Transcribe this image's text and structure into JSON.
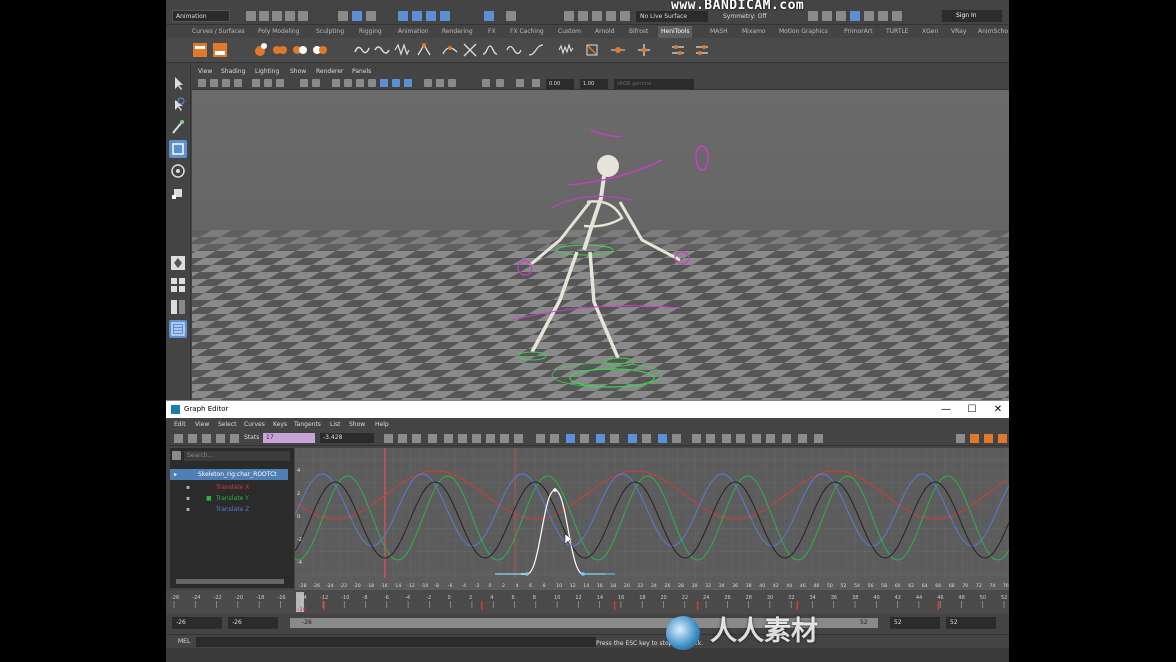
{
  "watermark_top": "www.BANDICAM.com",
  "status_line": {
    "mode": "Animation",
    "live_surface": "No Live Surface",
    "symmetry": "Symmetry: Off",
    "sign_in": "Sign In"
  },
  "shelf": {
    "tabs": [
      "Curves / Surfaces",
      "Poly Modeling",
      "Sculpting",
      "Rigging",
      "Animation",
      "Rendering",
      "FX",
      "FX Caching",
      "Custom",
      "Arnold",
      "Bifrost",
      "HeniTools",
      "MASH",
      "Mixamo",
      "Motion Graphics",
      "PrimorArt",
      "TURTLE",
      "XGen",
      "VRay",
      "AnimScho"
    ],
    "active_tab": "HeniTools"
  },
  "viewport": {
    "menus": [
      "View",
      "Shading",
      "Lighting",
      "Show",
      "Renderer",
      "Panels"
    ],
    "field_near": "0.00",
    "field_far": "1.00",
    "color_space": "sRGB gamma"
  },
  "graph_editor": {
    "title": "Graph Editor",
    "window_buttons": {
      "minimize": "—",
      "maximize": "☐",
      "close": "✕"
    },
    "menus": [
      "Edit",
      "View",
      "Select",
      "Curves",
      "Keys",
      "Tangents",
      "List",
      "Show",
      "Help"
    ],
    "stats_label": "Stats",
    "stats_frame": "17",
    "stats_value": "-3.428",
    "search_placeholder": "Search...",
    "outliner": {
      "root": "Skeleton_rig:char_ROOTCt",
      "channels": [
        "Translate X",
        "Translate Y",
        "Translate Z"
      ]
    },
    "y_ticks": [
      "4",
      "2",
      "0",
      "-2",
      "-4"
    ],
    "x_ticks": [
      "-28",
      "-26",
      "-24",
      "-22",
      "-20",
      "-18",
      "-16",
      "-14",
      "-12",
      "-10",
      "-8",
      "-6",
      "-4",
      "-2",
      "0",
      "2",
      "4",
      "6",
      "8",
      "10",
      "12",
      "14",
      "16",
      "18",
      "20",
      "22",
      "24",
      "26",
      "28",
      "30",
      "32",
      "34",
      "36",
      "38",
      "40",
      "42",
      "44",
      "46",
      "48",
      "50",
      "52",
      "54",
      "56",
      "58",
      "60",
      "62",
      "64",
      "66",
      "68",
      "70",
      "72",
      "74",
      "76"
    ]
  },
  "time_slider": {
    "ticks": [
      "-26",
      "-24",
      "-22",
      "-20",
      "-18",
      "-16",
      "-14",
      "-12",
      "-10",
      "-8",
      "-6",
      "-4",
      "-2",
      "0",
      "2",
      "4",
      "6",
      "8",
      "10",
      "12",
      "14",
      "16",
      "18",
      "20",
      "22",
      "24",
      "26",
      "28",
      "30",
      "32",
      "34",
      "36",
      "38",
      "40",
      "42",
      "44",
      "46",
      "48",
      "50",
      "52"
    ],
    "current": "-16"
  },
  "range": {
    "start": "-26",
    "anim_start": "-26",
    "slider_start": "-26",
    "slider_end": "52",
    "anim_end": "52",
    "end": "52"
  },
  "command": {
    "label": "MEL",
    "help": "Press the ESC key to stop playback."
  },
  "cn_watermark": "人人素材",
  "colors": {
    "translate_x": "#d23b3b",
    "translate_y": "#2ab44a",
    "translate_z": "#5b7ad8",
    "selection": "#5c8fd6",
    "rig_controls": "#d03ad0"
  }
}
